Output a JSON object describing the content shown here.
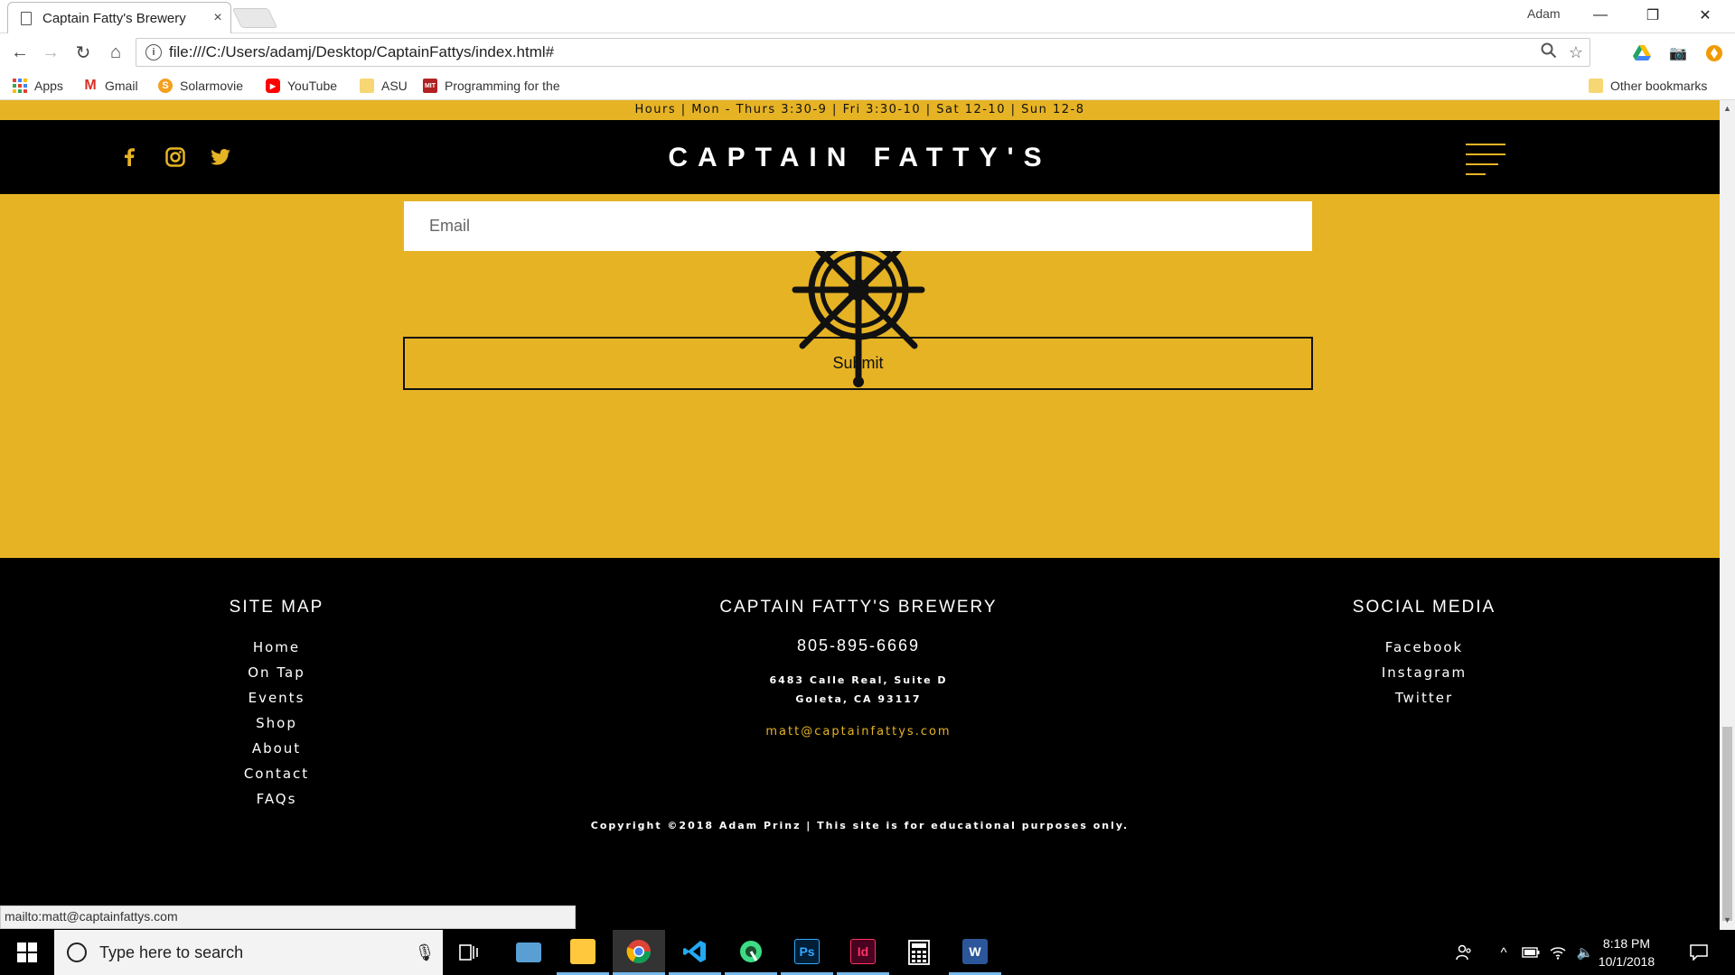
{
  "browser": {
    "tab_title": "Captain Fatty's Brewery",
    "tab_close": "×",
    "profile_name": "Adam",
    "url": "file:///C:/Users/adamj/Desktop/CaptainFattys/index.html#",
    "window_controls": {
      "minimize": "—",
      "restore": "❐",
      "close": "✕"
    },
    "bookmarks": [
      {
        "label": "Apps",
        "icon": "apps-grid-icon",
        "color": "#e44134"
      },
      {
        "label": "Gmail",
        "icon": "gmail-icon",
        "color": "#d93025"
      },
      {
        "label": "Solarmovie",
        "icon": "solarmovie-icon",
        "color": "#f4a020"
      },
      {
        "label": "YouTube",
        "icon": "youtube-icon",
        "color": "#ff0000"
      },
      {
        "label": "ASU",
        "icon": "folder-icon",
        "color": "#f7d774"
      },
      {
        "label": "Programming for the",
        "icon": "site-icon",
        "color": "#b22222"
      }
    ],
    "other_bookmarks": "Other bookmarks",
    "status_url": "mailto:matt@captainfattys.com"
  },
  "site": {
    "hours": "Hours | Mon - Thurs 3:30-9 | Fri 3:30-10 | Sat 12-10 | Sun 12-8",
    "brand": "CAPTAIN FATTY'S",
    "accent": "#e6b325",
    "form": {
      "email_placeholder": "Email",
      "submit_label": "Submit"
    },
    "footer": {
      "sitemap_title": "SITE MAP",
      "sitemap_links": [
        "Home",
        "On Tap",
        "Events",
        "Shop",
        "About",
        "Contact",
        "FAQs"
      ],
      "brewery_title": "CAPTAIN FATTY'S BREWERY",
      "phone": "805-895-6669",
      "address_line1": "6483 Calle Real, Suite D",
      "address_line2": "Goleta, CA 93117",
      "email": "matt@captainfattys.com",
      "social_title": "SOCIAL MEDIA",
      "social_links": [
        "Facebook",
        "Instagram",
        "Twitter"
      ],
      "copyright": "Copyright ©2018 Adam Prinz | This site is for educational purposes only."
    }
  },
  "taskbar": {
    "search_placeholder": "Type here to search",
    "time": "8:18 PM",
    "date": "10/1/2018",
    "apps": [
      {
        "name": "file-explorer-icon",
        "glyph": "",
        "color": "#ffc83d"
      },
      {
        "name": "chrome-icon",
        "glyph": "",
        "color": "#4285f4"
      },
      {
        "name": "vscode-icon",
        "glyph": "",
        "color": "#23a9f2"
      },
      {
        "name": "android-studio-icon",
        "glyph": "",
        "color": "#3ddc84"
      },
      {
        "name": "photoshop-icon",
        "glyph": "Ps",
        "color": "#31a8ff"
      },
      {
        "name": "indesign-icon",
        "glyph": "Id",
        "color": "#ff3366"
      },
      {
        "name": "calculator-icon",
        "glyph": "",
        "color": "#ffffff"
      },
      {
        "name": "word-icon",
        "glyph": "W",
        "color": "#2b579a"
      }
    ]
  }
}
